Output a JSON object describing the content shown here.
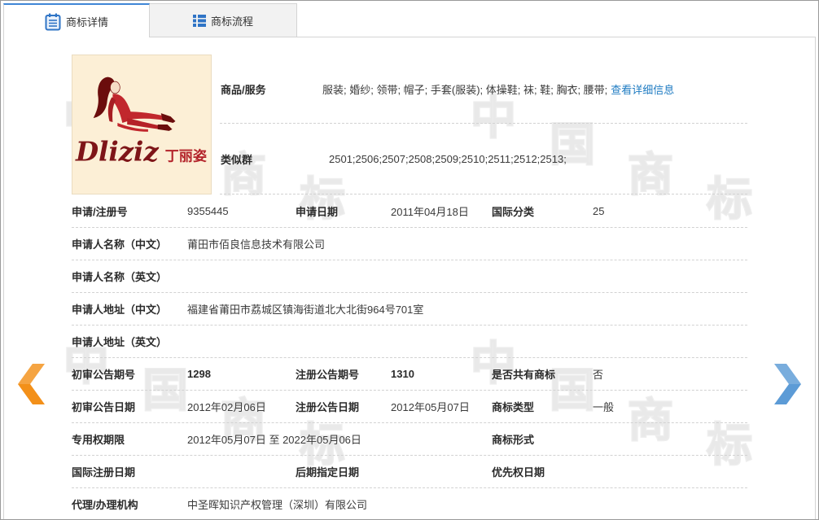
{
  "colors": {
    "tab_active_border": "#3f86d6",
    "icon_blue": "#2f74c6",
    "link": "#1e7bc2",
    "prev_arrow": "#f39019",
    "next_arrow": "#5c9bd6",
    "logo_bg": "#fcefd6",
    "logo_red": "#7e1518",
    "logo_cn_red": "#b3232a"
  },
  "tabs": [
    {
      "label": "商标详情",
      "icon": "document-icon"
    },
    {
      "label": "商标流程",
      "icon": "list-icon"
    }
  ],
  "trademark": {
    "logo_text": "Dliziz",
    "logo_cn": "丁丽姿"
  },
  "goods_services": {
    "label": "商品/服务",
    "value": "服装; 婚纱; 领带; 帽子; 手套(服装); 体操鞋; 袜; 鞋; 胸衣; 腰带;",
    "detail_link": "查看详细信息"
  },
  "similar_groups": {
    "label": "类似群",
    "value": "2501;2506;2507;2508;2509;2510;2511;2512;2513;"
  },
  "fields": {
    "reg_no": {
      "label": "申请/注册号",
      "value": "9355445"
    },
    "apply_date": {
      "label": "申请日期",
      "value": "2011年04月18日"
    },
    "intl_class": {
      "label": "国际分类",
      "value": "25"
    },
    "applicant_name_cn": {
      "label": "申请人名称（中文）",
      "value": "莆田市佰良信息技术有限公司"
    },
    "applicant_name_en": {
      "label": "申请人名称（英文）",
      "value": ""
    },
    "applicant_addr_cn": {
      "label": "申请人地址（中文）",
      "value": "福建省莆田市荔城区镇海街道北大北街964号701室"
    },
    "applicant_addr_en": {
      "label": "申请人地址（英文）",
      "value": ""
    },
    "prelim_pub_issue": {
      "label": "初审公告期号",
      "value": "1298"
    },
    "reg_pub_issue": {
      "label": "注册公告期号",
      "value": "1310"
    },
    "shared_mark": {
      "label": "是否共有商标",
      "value": "否"
    },
    "prelim_pub_date": {
      "label": "初审公告日期",
      "value": "2012年02月06日"
    },
    "reg_pub_date": {
      "label": "注册公告日期",
      "value": "2012年05月07日"
    },
    "mark_type": {
      "label": "商标类型",
      "value": "一般"
    },
    "exclusive_period": {
      "label": "专用权期限",
      "value": "2012年05月07日 至 2022年05月06日"
    },
    "mark_form": {
      "label": "商标形式",
      "value": ""
    },
    "intl_reg_date": {
      "label": "国际注册日期",
      "value": ""
    },
    "later_designation_date": {
      "label": "后期指定日期",
      "value": ""
    },
    "priority_date": {
      "label": "优先权日期",
      "value": ""
    },
    "agency": {
      "label": "代理/办理机构",
      "value": "中圣晖知识产权管理（深圳）有限公司"
    }
  },
  "navigation": {
    "prev_icon": "chevron-left-icon",
    "next_icon": "chevron-right-icon"
  },
  "watermark": {
    "chars": [
      "中",
      "国",
      "商",
      "标"
    ]
  }
}
